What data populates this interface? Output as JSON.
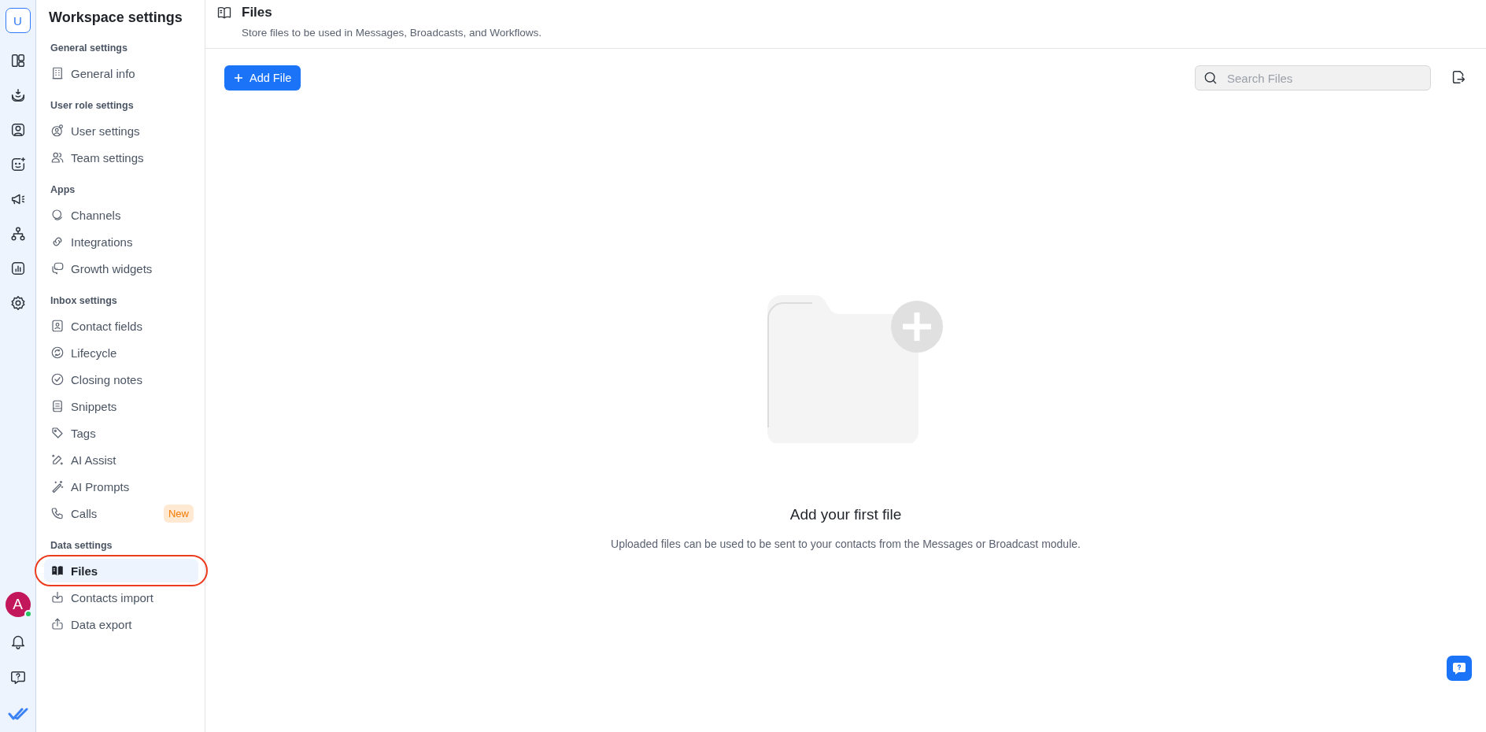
{
  "rail": {
    "workspace_initial": "U",
    "avatar": {
      "initial": "A",
      "online": true
    }
  },
  "sidebar": {
    "title": "Workspace settings",
    "sections": [
      {
        "heading": "General settings",
        "items": [
          {
            "label": "General info",
            "selected": false
          }
        ]
      },
      {
        "heading": "User role settings",
        "items": [
          {
            "label": "User settings",
            "selected": false
          },
          {
            "label": "Team settings",
            "selected": false
          }
        ]
      },
      {
        "heading": "Apps",
        "items": [
          {
            "label": "Channels",
            "selected": false
          },
          {
            "label": "Integrations",
            "selected": false
          },
          {
            "label": "Growth widgets",
            "selected": false
          }
        ]
      },
      {
        "heading": "Inbox settings",
        "items": [
          {
            "label": "Contact fields",
            "selected": false
          },
          {
            "label": "Lifecycle",
            "selected": false
          },
          {
            "label": "Closing notes",
            "selected": false
          },
          {
            "label": "Snippets",
            "selected": false
          },
          {
            "label": "Tags",
            "selected": false
          },
          {
            "label": "AI Assist",
            "selected": false
          },
          {
            "label": "AI Prompts",
            "selected": false
          },
          {
            "label": "Calls",
            "selected": false,
            "badge": "New"
          }
        ]
      },
      {
        "heading": "Data settings",
        "items": [
          {
            "label": "Files",
            "selected": true,
            "circled": true
          },
          {
            "label": "Contacts import",
            "selected": false
          },
          {
            "label": "Data export",
            "selected": false
          }
        ]
      }
    ]
  },
  "page": {
    "title": "Files",
    "subtitle": "Store files to be used in Messages, Broadcasts, and Workflows."
  },
  "toolbar": {
    "add_button": "Add File",
    "search": {
      "placeholder": "Search Files"
    }
  },
  "empty_state": {
    "title": "Add your first file",
    "text": "Uploaded files can be used to be sent to your contacts from the Messages or Broadcast module."
  }
}
